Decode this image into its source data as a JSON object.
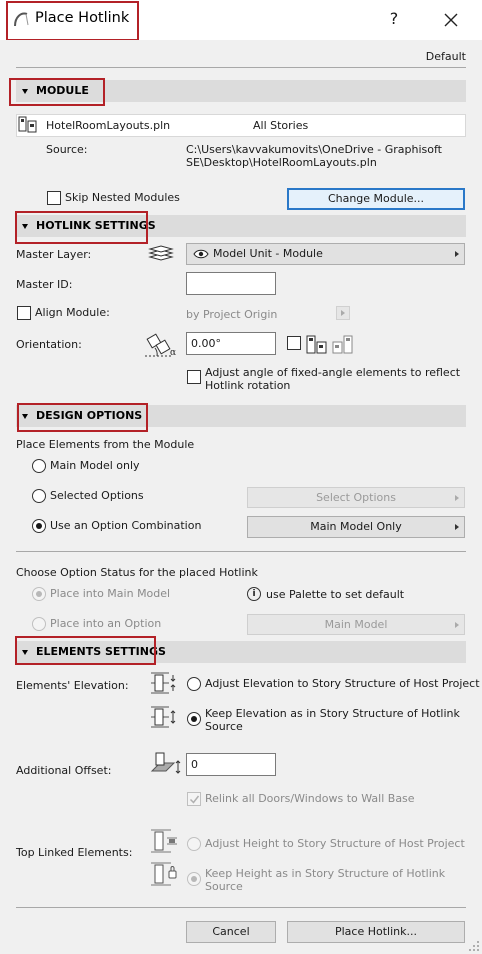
{
  "window": {
    "title": "Place Hotlink",
    "help_label": "?",
    "default_label": "Default"
  },
  "module": {
    "section_label": "MODULE",
    "file_name": "HotelRoomLayouts.pln",
    "stories": "All Stories",
    "source_label": "Source:",
    "source_path_line1": "C:\\Users\\kavvakumovits\\OneDrive - Graphisoft",
    "source_path_line2": "SE\\Desktop\\HotelRoomLayouts.pln",
    "skip_nested_label": "Skip Nested Modules",
    "skip_nested_checked": false,
    "change_module_label": "Change Module..."
  },
  "hotlink_settings": {
    "section_label": "HOTLINK SETTINGS",
    "master_layer_label": "Master Layer:",
    "master_layer_value": "Model Unit - Module",
    "master_id_label": "Master ID:",
    "master_id_value": "",
    "align_module_label": "Align Module:",
    "align_module_checked": false,
    "align_by_label": "by Project Origin",
    "orientation_label": "Orientation:",
    "orientation_value": "0.00°",
    "adjust_angle_line1": "Adjust angle of fixed-angle elements to reflect",
    "adjust_angle_line2": "Hotlink rotation",
    "adjust_angle_checked": false
  },
  "design_options": {
    "section_label": "DESIGN OPTIONS",
    "place_elements_label": "Place Elements from the Module",
    "radio_main_model": "Main Model only",
    "radio_selected_options": "Selected Options",
    "radio_option_combination": "Use an Option Combination",
    "selected": "option_combination",
    "select_options_label": "Select Options",
    "combination_value": "Main Model Only",
    "choose_status_label": "Choose Option Status for the placed Hotlink",
    "place_main_model": "Place into Main Model",
    "place_option": "Place into an Option",
    "palette_hint": "use Palette to set default",
    "info_glyph": "i",
    "status_dropdown_value": "Main Model"
  },
  "elements_settings": {
    "section_label": "ELEMENTS SETTINGS",
    "elevation_label": "Elements' Elevation:",
    "elev_adjust_label": "Adjust Elevation to Story Structure of Host Project",
    "elev_keep_line1": "Keep Elevation as in Story Structure of Hotlink",
    "elev_keep_line2": "Source",
    "elevation_selected": "keep",
    "additional_offset_label": "Additional Offset:",
    "additional_offset_value": "0",
    "relink_label": "Relink all Doors/Windows to Wall Base",
    "relink_checked": true,
    "top_linked_label": "Top Linked Elements:",
    "height_adjust_label": "Adjust Height to Story Structure of Host Project",
    "height_keep_line1": "Keep Height as in Story Structure of Hotlink",
    "height_keep_line2": "Source",
    "height_selected": "keep"
  },
  "footer": {
    "cancel_label": "Cancel",
    "place_label": "Place Hotlink..."
  },
  "colors": {
    "highlight_red": "#b32127",
    "focus_blue": "#2a78c8",
    "section_bar": "#dcdcdc",
    "panel_bg": "#f0f0f0"
  }
}
